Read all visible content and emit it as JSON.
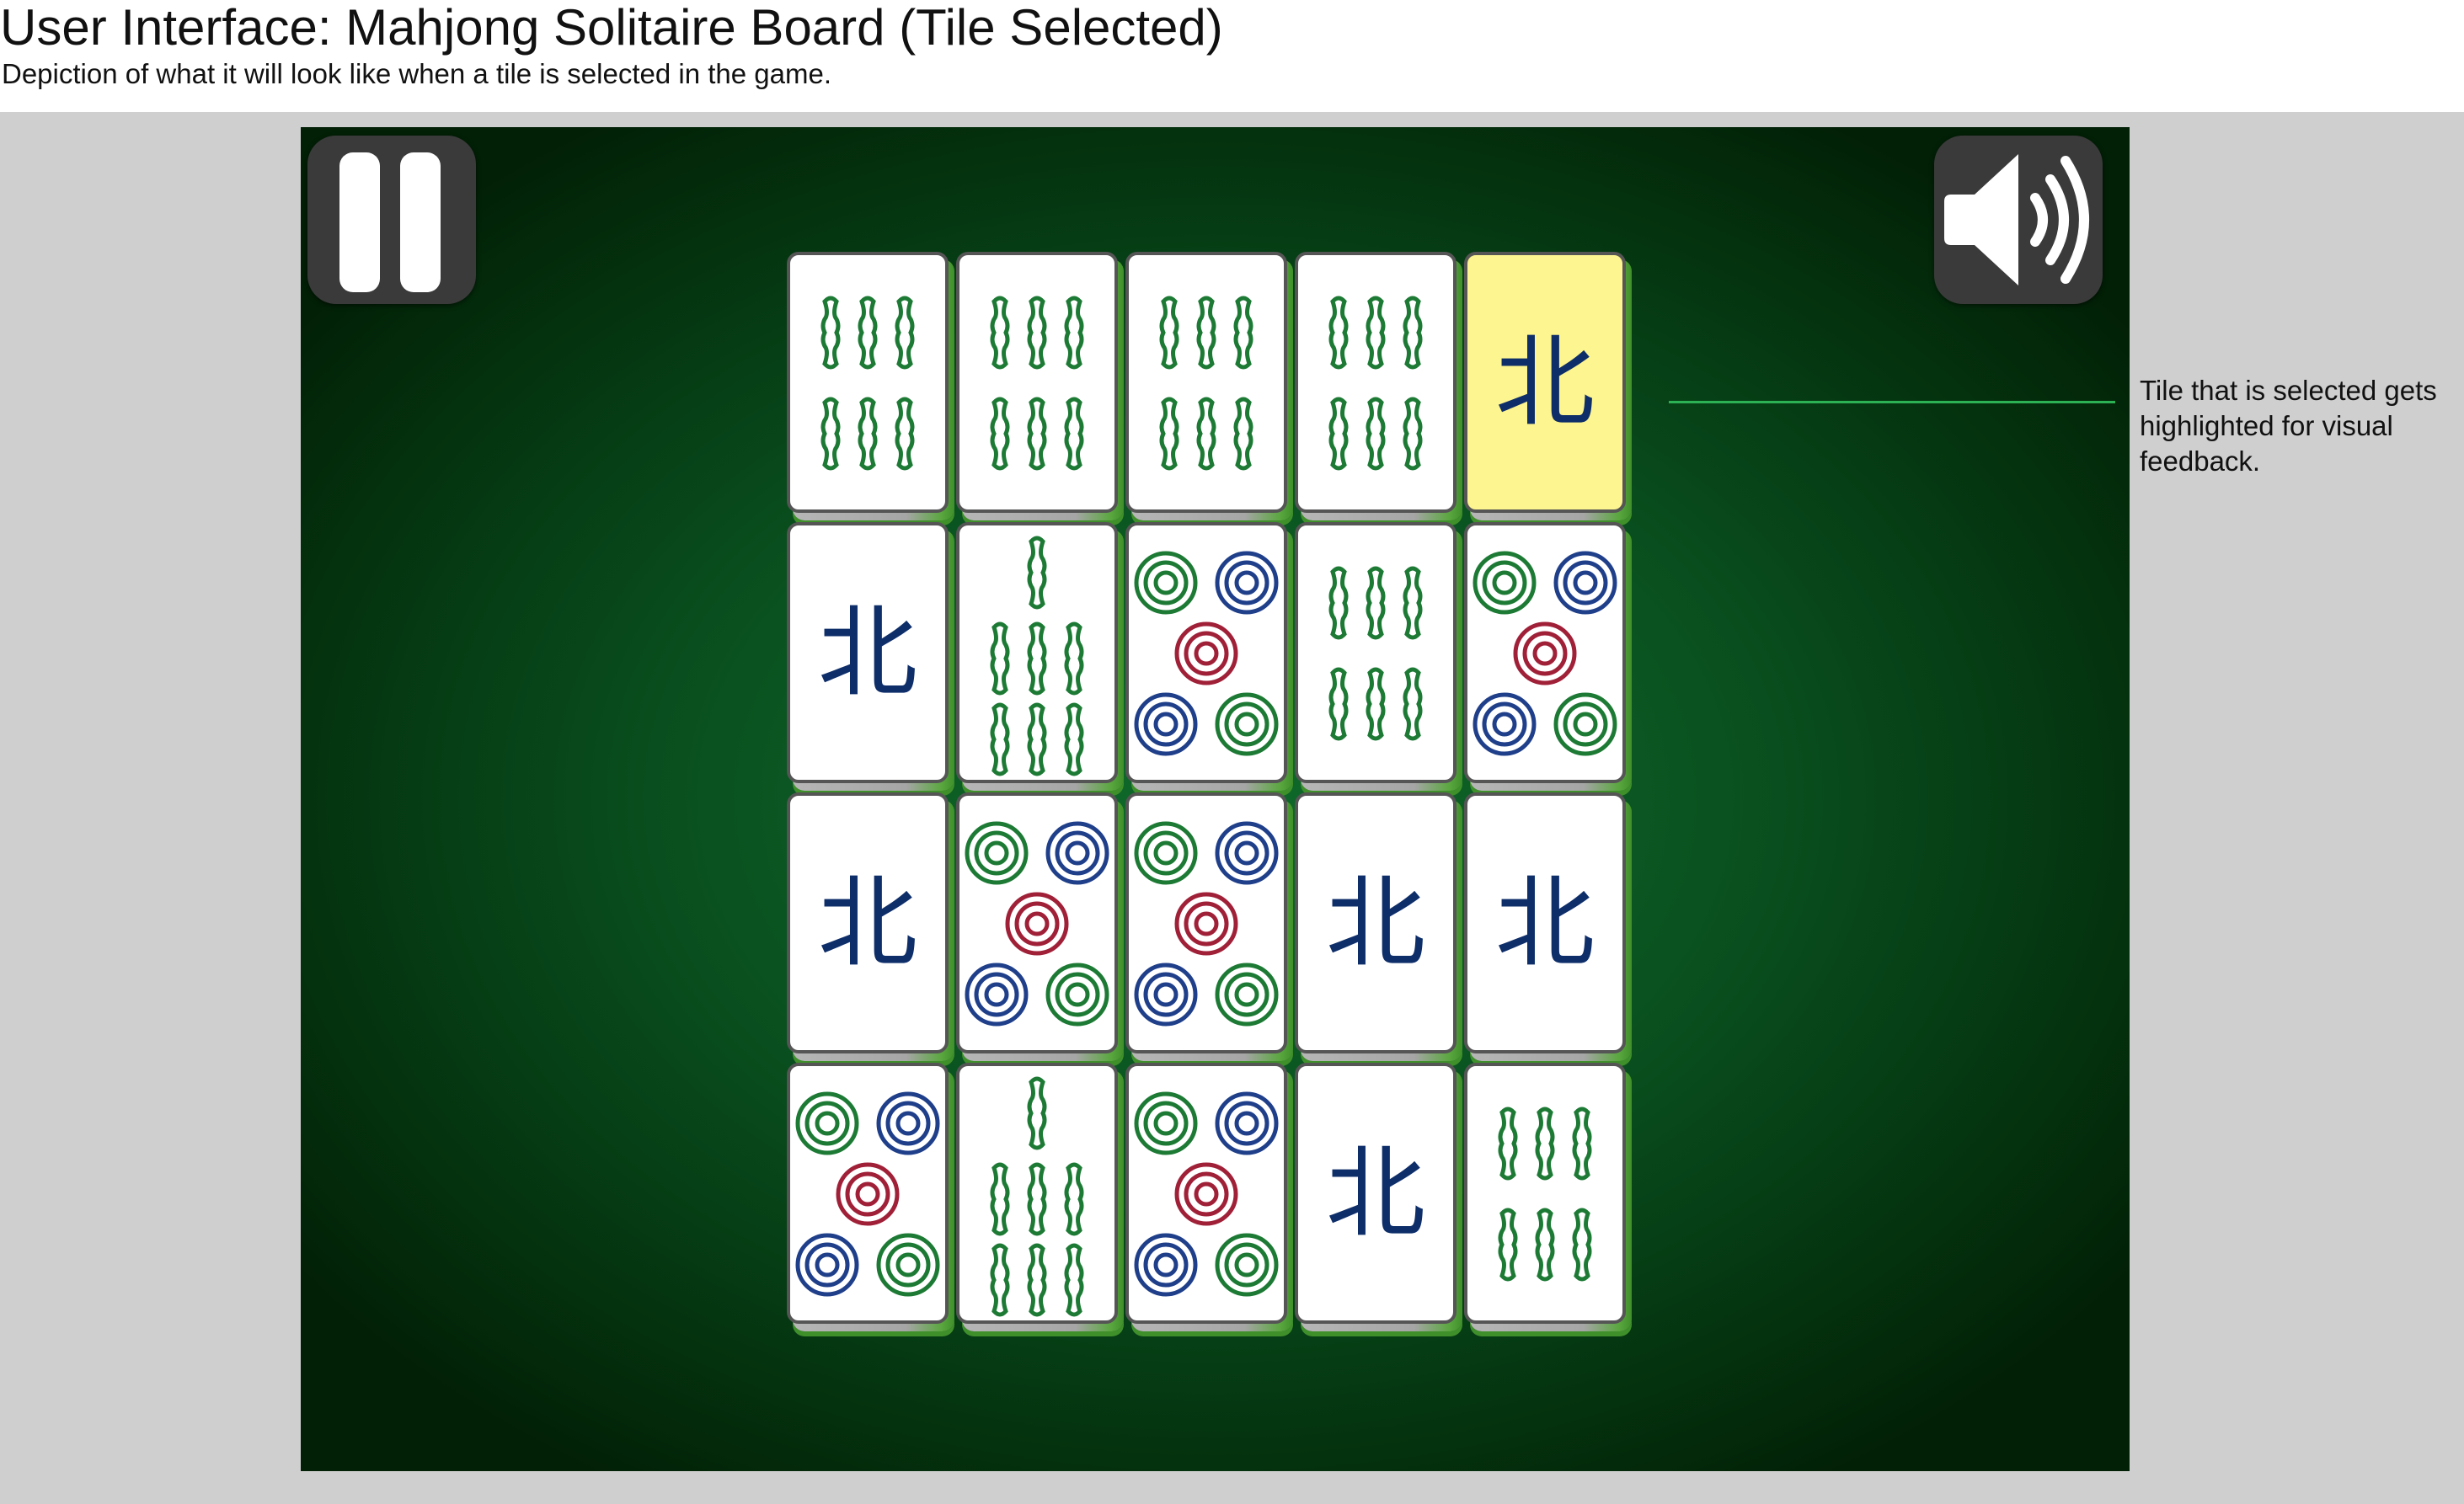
{
  "doc": {
    "title": "User Interface: Mahjong Solitaire Board (Tile Selected)",
    "subtitle": "Depiction of what it will look like when a tile is selected in the game."
  },
  "game": {
    "pause_icon": "pause-icon",
    "sound_icon": "speaker-volume-icon",
    "colors": {
      "felt": "#0a5220",
      "tile_face": "#ffffff",
      "tile_selected": "#fdf58f",
      "tile_side": "#3f8f2b",
      "bamboo": "#1d7a35",
      "circle_green": "#1d7a35",
      "circle_blue": "#1f3f8a",
      "circle_red": "#a02038",
      "character": "#0e2e6a"
    }
  },
  "board": {
    "rows": [
      [
        "bamboo-6",
        "bamboo-6",
        "bamboo-6",
        "bamboo-6",
        "north"
      ],
      [
        "north",
        "bamboo-7",
        "circle-5",
        "bamboo-6",
        "circle-5"
      ],
      [
        "north",
        "circle-5",
        "circle-5",
        "north",
        "north"
      ],
      [
        "circle-5",
        "bamboo-7",
        "circle-5",
        "north",
        "bamboo-6"
      ]
    ],
    "selected": {
      "row": 0,
      "col": 4
    },
    "north_glyph": "北"
  },
  "callout": {
    "text": "Tile that is selected gets highlighted for visual feedback."
  }
}
